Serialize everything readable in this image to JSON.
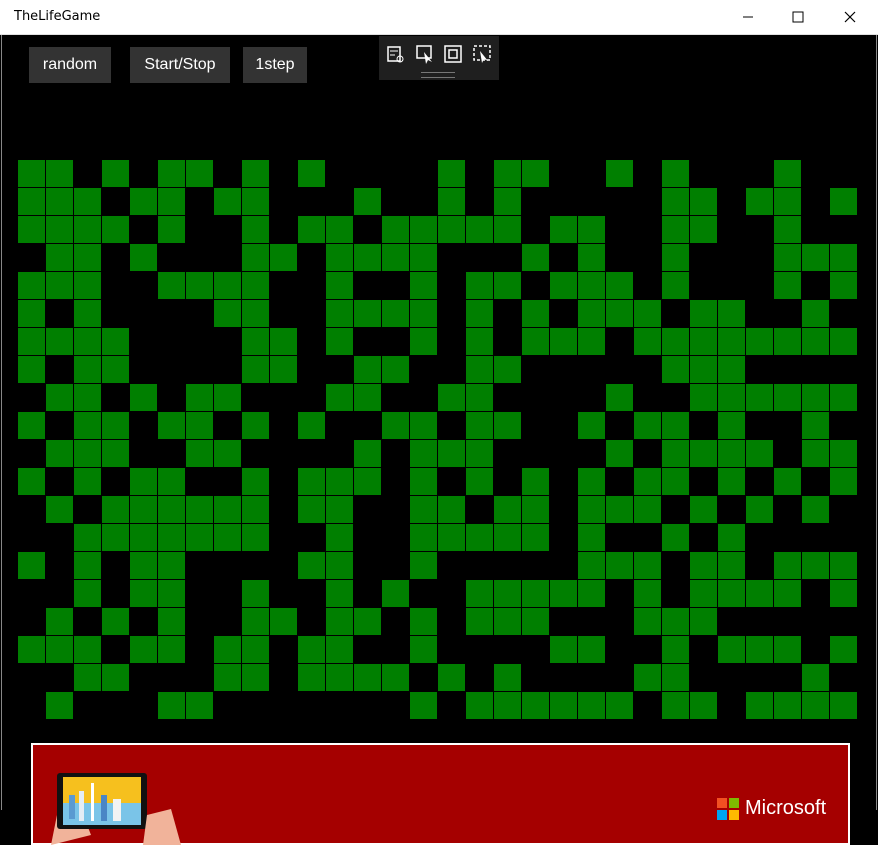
{
  "window": {
    "title": "TheLifeGame"
  },
  "toolbar": {
    "random_label": "random",
    "startstop_label": "Start/Stop",
    "step_label": "1step"
  },
  "ad": {
    "brand": "Microsoft",
    "colors": {
      "background": "#a50000",
      "logo": [
        "#f25022",
        "#7fba00",
        "#00a4ef",
        "#ffb900"
      ]
    }
  },
  "board": {
    "cols": 30,
    "rows": 20,
    "live_color": "#007f00",
    "grid": [
      "110101101010000101100101000100",
      "111011011000100101000001101101",
      "111101001011011111011001100100",
      "011010001101111000101001000111",
      "111001111001001011011101000101",
      "101000011001111010101110110010",
      "111100001101001010111011111111",
      "101100001100110011000001110000",
      "011010110001100110000100111111",
      "101101101010011011001011010010",
      "011100110000101110000101111011",
      "101011001011101010101011010101",
      "010111111011001101101110101010",
      "001111111001001111101001010000",
      "101011000011001000001110110111",
      "001011001001010011111010111101",
      "010101001101101011100011100000",
      "111011011011001000011001011101",
      "001100011011110101000011000010",
      "010001100000001011111101101111"
    ]
  }
}
